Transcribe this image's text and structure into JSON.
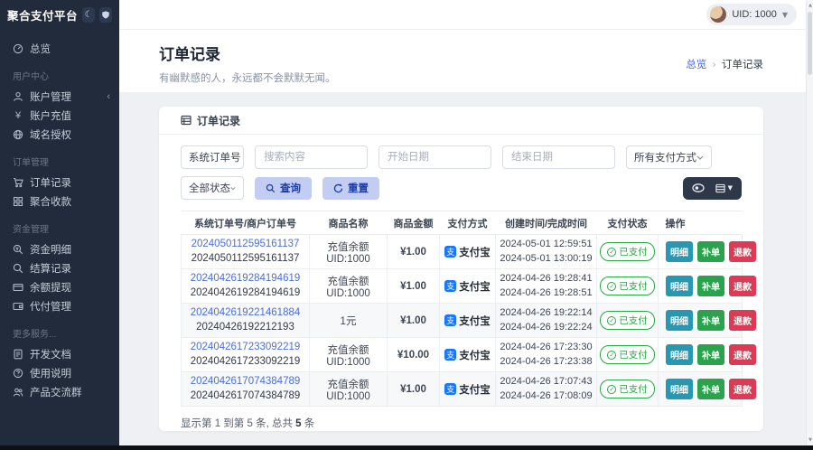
{
  "app": {
    "brand": "聚合支付平台"
  },
  "topbar": {
    "uid_label": "UID: 1000"
  },
  "sidebar": {
    "overview": {
      "icon": "dashboard-icon",
      "label": "总览"
    },
    "sections": [
      {
        "label": "用户中心",
        "items": [
          {
            "icon": "user-icon",
            "label": "账户管理",
            "chevron": "‹"
          },
          {
            "icon": "yen-icon",
            "label": "账户充值"
          },
          {
            "icon": "globe-icon",
            "label": "域名授权"
          }
        ]
      },
      {
        "label": "订单管理",
        "items": [
          {
            "icon": "cart-icon",
            "label": "订单记录"
          },
          {
            "icon": "grid-icon",
            "label": "聚合收款"
          }
        ]
      },
      {
        "label": "资金管理",
        "items": [
          {
            "icon": "search-yen-icon",
            "label": "资金明细"
          },
          {
            "icon": "search-icon",
            "label": "结算记录"
          },
          {
            "icon": "card-icon",
            "label": "余额提现"
          },
          {
            "icon": "wallet-icon",
            "label": "代付管理"
          }
        ]
      },
      {
        "label": "更多服务...",
        "items": [
          {
            "icon": "doc-icon",
            "label": "开发文档"
          },
          {
            "icon": "help-icon",
            "label": "使用说明"
          },
          {
            "icon": "users-icon",
            "label": "产品交流群"
          }
        ]
      }
    ]
  },
  "page_header": {
    "title": "订单记录",
    "subtitle": "有幽默感的人，永远都不会默默无闻。",
    "breadcrumb": {
      "root": "总览",
      "current": "订单记录"
    }
  },
  "card": {
    "header_title": "订单记录",
    "filters": {
      "order_type_select": "系统订单号",
      "search_placeholder": "搜索内容",
      "start_date_placeholder": "开始日期",
      "end_date_placeholder": "结束日期",
      "pay_method_select": "所有支付方式",
      "status_select": "全部状态",
      "query_label": "查询",
      "reset_label": "重置"
    },
    "table": {
      "headers": [
        "系统订单号/商户订单号",
        "商品名称",
        "商品金额",
        "支付方式",
        "创建时间/完成时间",
        "支付状态",
        "操作"
      ],
      "pay_method": "支付宝",
      "status_label": "已支付",
      "actions": [
        "明细",
        "补单",
        "退款"
      ],
      "rows": [
        {
          "sys_no": "2024050112595161137",
          "merch_no": "2024050112595161137",
          "product": "充值余额 UID:1000",
          "amount": "¥1.00",
          "created": "2024-05-01 12:59:51",
          "completed": "2024-05-01 13:00:19"
        },
        {
          "sys_no": "2024042619284194619",
          "merch_no": "2024042619284194619",
          "product": "充值余额 UID:1000",
          "amount": "¥1.00",
          "created": "2024-04-26 19:28:41",
          "completed": "2024-04-26 19:28:51"
        },
        {
          "sys_no": "2024042619221461884",
          "merch_no": "20240426192212193",
          "product": "1元",
          "amount": "¥1.00",
          "created": "2024-04-26 19:22:14",
          "completed": "2024-04-26 19:22:24"
        },
        {
          "sys_no": "2024042617233092219",
          "merch_no": "2024042617233092219",
          "product": "充值余额 UID:1000",
          "amount": "¥10.00",
          "created": "2024-04-26 17:23:30",
          "completed": "2024-04-26 17:23:38"
        },
        {
          "sys_no": "2024042617074384789",
          "merch_no": "2024042617074384789",
          "product": "充值余额 UID:1000",
          "amount": "¥1.00",
          "created": "2024-04-26 17:07:43",
          "completed": "2024-04-26 17:08:09"
        }
      ]
    },
    "footer": {
      "prefix": "显示第 1 到第 5 条, 总共 ",
      "total": "5",
      "suffix": " 条"
    }
  },
  "colors": {
    "sidebar_bg": "#212b3b",
    "accent_blue": "#4065d9",
    "link_blue": "#4a6edb",
    "alipay_blue": "#1677ff",
    "status_green": "#28a745",
    "action_teal": "#2797b2",
    "action_green": "#2ba24c",
    "action_red": "#dc3a55",
    "filter_button_bg": "#c3cdf1",
    "filter_button_text": "#1b3da5"
  }
}
